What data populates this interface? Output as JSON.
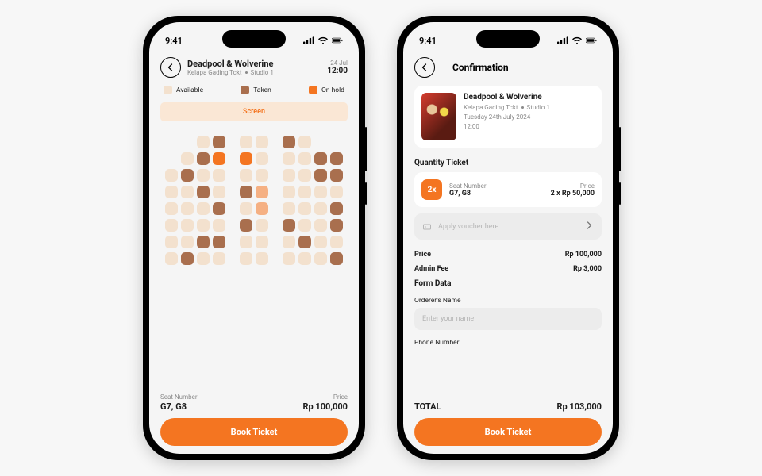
{
  "statusbar": {
    "time": "9:41"
  },
  "seat_screen": {
    "header": {
      "title": "Deadpool & Wolverine",
      "cinema": "Kelapa Gading Tckt",
      "studio": "Studio 1",
      "date": "24 Jul",
      "time": "12:00"
    },
    "legend": {
      "available": "Available",
      "taken": "Taken",
      "onhold": "On hold"
    },
    "screen_label": "Screen",
    "footer": {
      "seat_label": "Seat Number",
      "seat_value": "G7, G8",
      "price_label": "Price",
      "price_value": "Rp 100,000",
      "cta": "Book Ticket"
    },
    "seat_rows": [
      [
        "x",
        "x",
        "a",
        "t",
        "",
        "a",
        "a",
        "",
        "t",
        "a",
        "x",
        "x"
      ],
      [
        "x",
        "a",
        "t",
        "h",
        "",
        "h",
        "a",
        "",
        "a",
        "a",
        "t",
        "t"
      ],
      [
        "a",
        "t",
        "a",
        "a",
        "",
        "a",
        "a",
        "",
        "a",
        "a",
        "t",
        "t"
      ],
      [
        "a",
        "a",
        "t",
        "a",
        "",
        "t",
        "m",
        "",
        "a",
        "a",
        "a",
        "a"
      ],
      [
        "a",
        "a",
        "a",
        "t",
        "",
        "a",
        "m",
        "",
        "a",
        "a",
        "a",
        "t"
      ],
      [
        "a",
        "a",
        "a",
        "a",
        "",
        "t",
        "a",
        "",
        "t",
        "a",
        "a",
        "t"
      ],
      [
        "a",
        "a",
        "t",
        "t",
        "",
        "a",
        "a",
        "",
        "a",
        "t",
        "a",
        "a"
      ],
      [
        "a",
        "t",
        "a",
        "a",
        "",
        "a",
        "a",
        "",
        "a",
        "a",
        "a",
        "t"
      ]
    ]
  },
  "confirm_screen": {
    "title": "Confirmation",
    "movie": {
      "title": "Deadpool & Wolverine",
      "cinema": "Kelapa Gading Tckt",
      "studio": "Studio 1",
      "date": "Tuesday 24th July 2024",
      "time": "12:00"
    },
    "qty_section": "Quantity Ticket",
    "qty": {
      "badge": "2x",
      "seat_label": "Seat Number",
      "seat_value": "G7, G8",
      "price_label": "Price",
      "price_value": "2 x Rp 50,000"
    },
    "voucher_placeholder": "Apply voucher here",
    "lines": {
      "price_k": "Price",
      "price_v": "Rp 100,000",
      "fee_k": "Admin Fee",
      "fee_v": "Rp 3,000"
    },
    "form_section": "Form Data",
    "form": {
      "name_label": "Orderer's Name",
      "name_placeholder": "Enter your name",
      "phone_label": "Phone Number"
    },
    "total_label": "TOTAL",
    "total_value": "Rp 103,000",
    "cta": "Book Ticket"
  }
}
